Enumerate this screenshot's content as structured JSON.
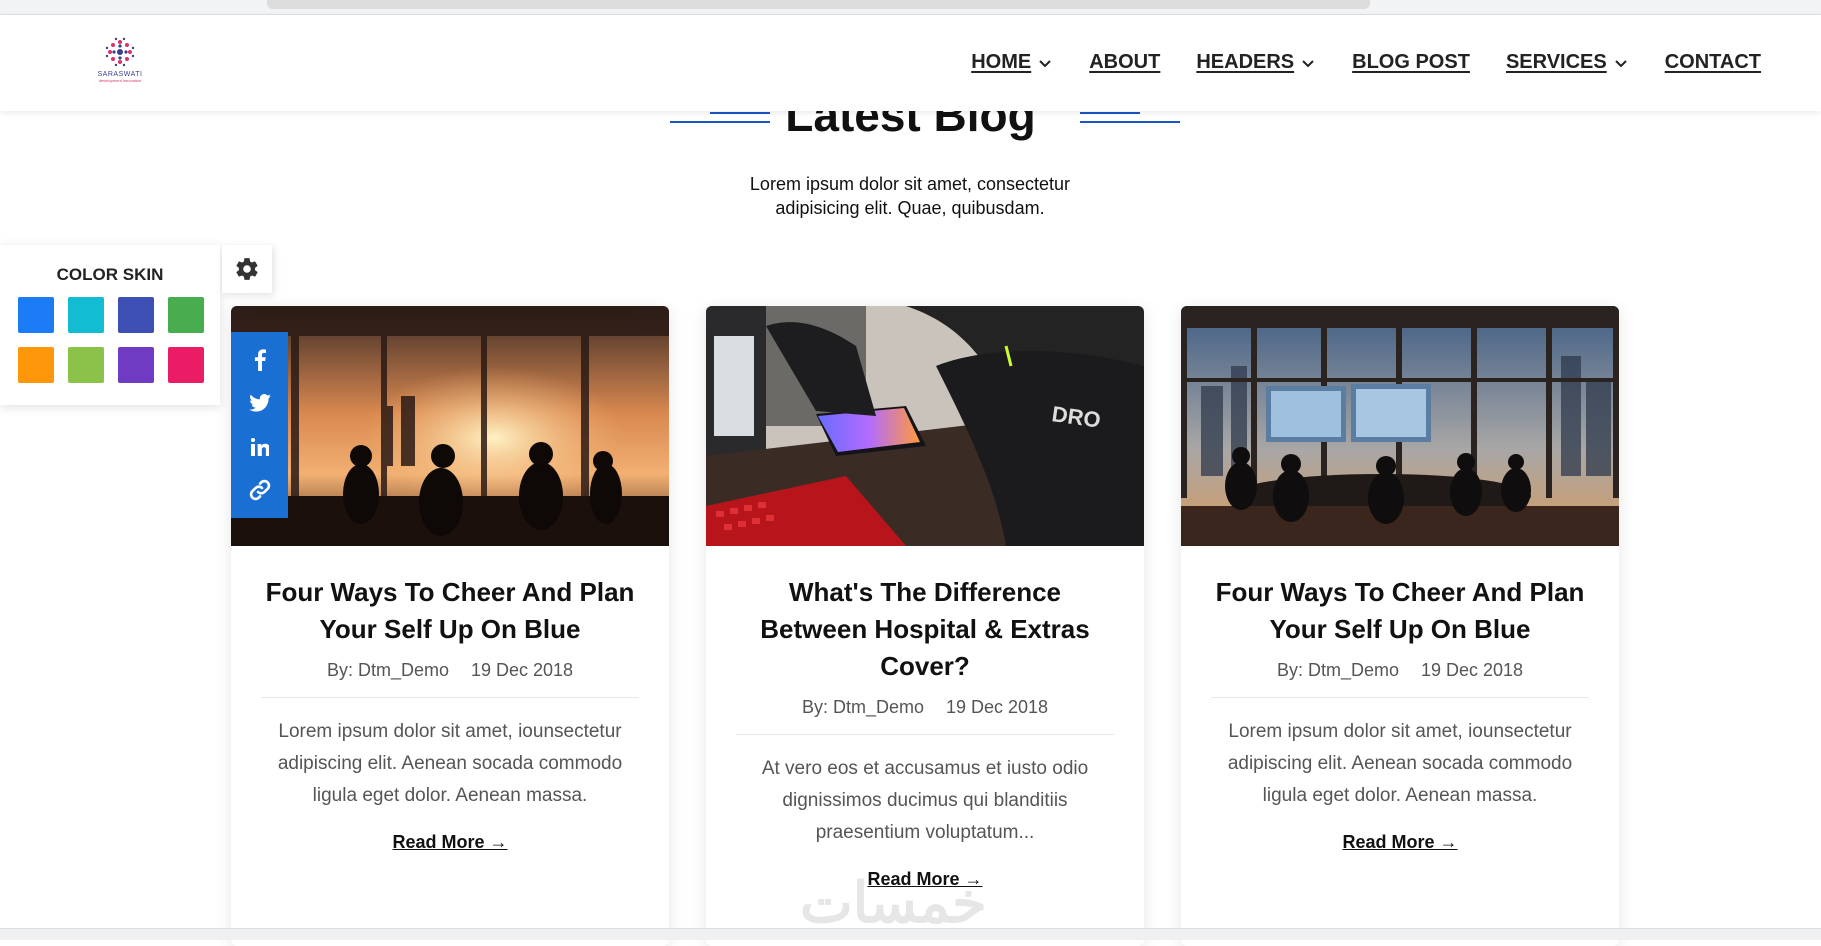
{
  "header": {
    "logo_name": "SARASWATI",
    "logo_tag": "development innovation",
    "nav": [
      {
        "label": "HOME",
        "dropdown": true
      },
      {
        "label": "ABOUT",
        "dropdown": false
      },
      {
        "label": "HEADERS",
        "dropdown": true
      },
      {
        "label": "BLOG POST",
        "dropdown": false
      },
      {
        "label": "SERVICES",
        "dropdown": true
      },
      {
        "label": "CONTACT",
        "dropdown": false
      }
    ]
  },
  "section": {
    "title": "Latest Blog",
    "subtitle": "Lorem ipsum dolor sit amet, consectetur adipisicing elit. Quae, quibusdam.",
    "accent_color": "#1a56c7"
  },
  "color_skin": {
    "title": "COLOR SKIN",
    "swatches": [
      "#1b7cf5",
      "#12bcd3",
      "#3d4fb5",
      "#48ad4e",
      "#fd9608",
      "#8bc249",
      "#6f3bc3",
      "#ea1c66"
    ]
  },
  "cards": [
    {
      "title": "Four Ways To Cheer And Plan Your Self Up On Blue",
      "author": "By: Dtm_Demo",
      "date": "19 Dec 2018",
      "excerpt": "Lorem ipsum dolor sit amet, iounsectetur adipiscing elit. Aenean socada commodo ligula eget dolor. Aenean massa.",
      "read_more": "Read More →",
      "image": "meeting-sunset"
    },
    {
      "title": "What's The Difference Between Hospital & Extras Cover?",
      "author": "By: Dtm_Demo",
      "date": "19 Dec 2018",
      "excerpt": "At vero eos et accusamus et iusto odio dignissimos ducimus qui blanditiis praesentium voluptatum...",
      "read_more": "Read More →",
      "image": "gamer-keyboard"
    },
    {
      "title": "Four Ways To Cheer And Plan Your Self Up On Blue",
      "author": "By: Dtm_Demo",
      "date": "19 Dec 2018",
      "excerpt": "Lorem ipsum dolor sit amet, iounsectetur adipiscing elit. Aenean socada commodo ligula eget dolor. Aenean massa.",
      "read_more": "Read More →",
      "image": "office-city"
    }
  ],
  "share_icons": [
    "facebook-icon",
    "twitter-icon",
    "linkedin-icon",
    "link-icon"
  ],
  "share_color": "#1a6fd3",
  "watermark": "خمسات"
}
